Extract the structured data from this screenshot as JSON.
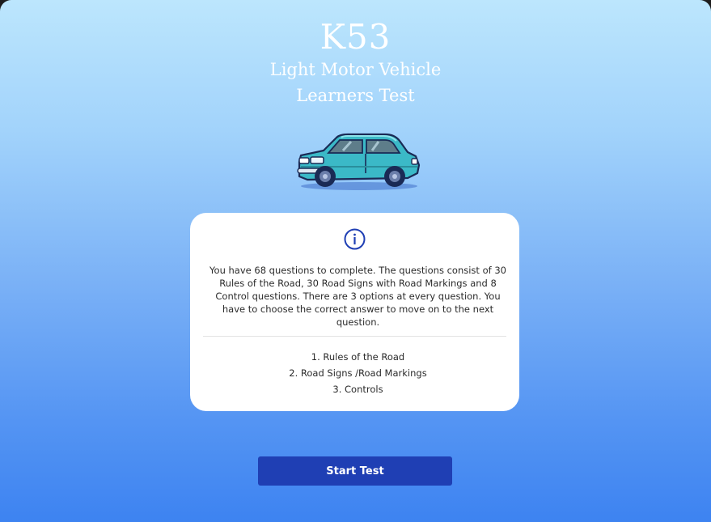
{
  "header": {
    "title": "K53",
    "subtitle_line1": "Light Motor Vehicle",
    "subtitle_line2": "Learners Test"
  },
  "illustration": {
    "icon": "car-icon",
    "body_color": "#3bb9c7"
  },
  "info_card": {
    "icon": "info-icon",
    "description": "You have 68 questions to complete. The questions consist of 30 Rules of the Road, 30 Road Signs with Road Markings and 8 Control questions. There are 3 options at every question. You have to choose the correct answer to move on to the next question.",
    "sections": [
      "1. Rules of the Road",
      "2. Road Signs /Road Markings",
      "3. Controls"
    ]
  },
  "actions": {
    "start_label": "Start Test"
  },
  "colors": {
    "button": "#1f3fb4",
    "icon": "#1f3fb4",
    "gradient_top": "#bce6fd",
    "gradient_bottom": "#3d83f1"
  }
}
